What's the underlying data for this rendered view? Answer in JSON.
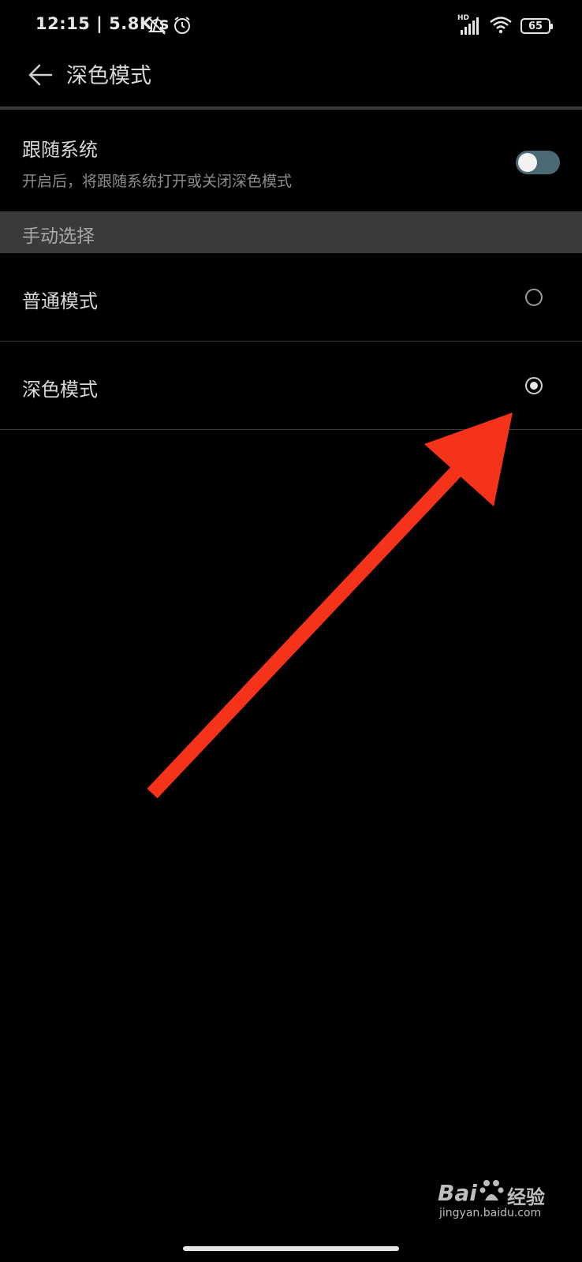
{
  "status_bar": {
    "time": "12:15 | 5.8K/s",
    "network_label": "HD",
    "battery": "65"
  },
  "header": {
    "title": "深色模式"
  },
  "follow_system": {
    "title": "跟随系统",
    "description": "开启后，将跟随系统打开或关闭深色模式",
    "enabled": false
  },
  "manual": {
    "section_label": "手动选择",
    "options": [
      {
        "label": "普通模式",
        "selected": false
      },
      {
        "label": "深色模式",
        "selected": true
      }
    ]
  },
  "watermark": {
    "brand_left": "Bai",
    "brand_right": "经验",
    "url": "jingyan.baidu.com"
  },
  "colors": {
    "background": "#000000",
    "toggle_track": "#4b6a74",
    "annotation_arrow": "#f5321a"
  }
}
